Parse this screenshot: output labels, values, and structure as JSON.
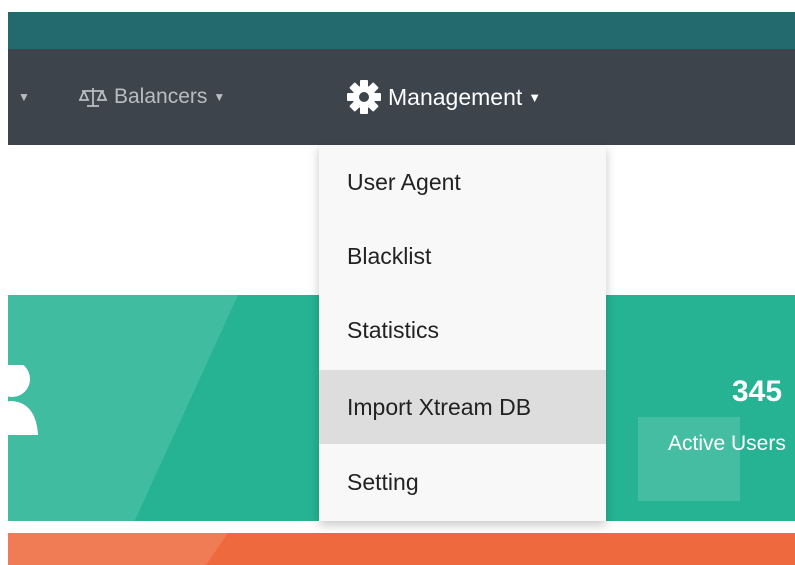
{
  "navbar": {
    "items": [
      {
        "label": "Balancers",
        "icon": "scales-icon"
      },
      {
        "label": "Management",
        "icon": "gear-icon"
      }
    ]
  },
  "management_menu": {
    "items": [
      {
        "label": "User Agent"
      },
      {
        "label": "Blacklist"
      },
      {
        "label": "Statistics"
      },
      {
        "label": "Import Xtream DB",
        "hovered": true
      },
      {
        "label": "Setting"
      }
    ]
  },
  "stat_card": {
    "value": "345",
    "label": "Active Users",
    "icon": "user-icon"
  },
  "colors": {
    "top_strip": "#236a6e",
    "navbar": "#3d444c",
    "stat_banner": "#26b394",
    "orange_banner": "#ee6a3e",
    "menu_bg": "#f8f8f8",
    "menu_hover": "#dddddd"
  }
}
